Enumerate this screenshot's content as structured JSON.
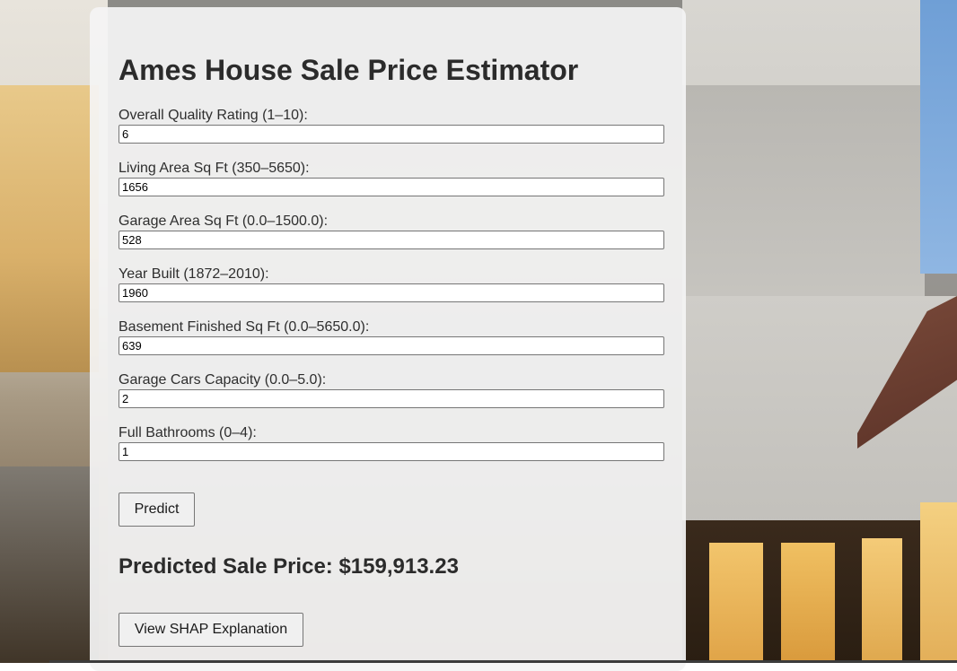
{
  "page": {
    "title": "Ames House Sale Price Estimator"
  },
  "form": {
    "fields": [
      {
        "label": "Overall Quality Rating (1–10):",
        "value": "6"
      },
      {
        "label": "Living Area Sq Ft (350–5650):",
        "value": "1656"
      },
      {
        "label": "Garage Area Sq Ft (0.0–1500.0):",
        "value": "528"
      },
      {
        "label": "Year Built (1872–2010):",
        "value": "1960"
      },
      {
        "label": "Basement Finished Sq Ft (0.0–5650.0):",
        "value": "639"
      },
      {
        "label": "Garage Cars Capacity (0.0–5.0):",
        "value": "2"
      },
      {
        "label": "Full Bathrooms (0–4):",
        "value": "1"
      }
    ],
    "predict_label": "Predict"
  },
  "result": {
    "text": "Predicted Sale Price: $159,913.23"
  },
  "shap": {
    "button_label": "View SHAP Explanation"
  },
  "colors": {
    "panel_bg": "#f4f4f4",
    "text": "#2b2b2b"
  }
}
